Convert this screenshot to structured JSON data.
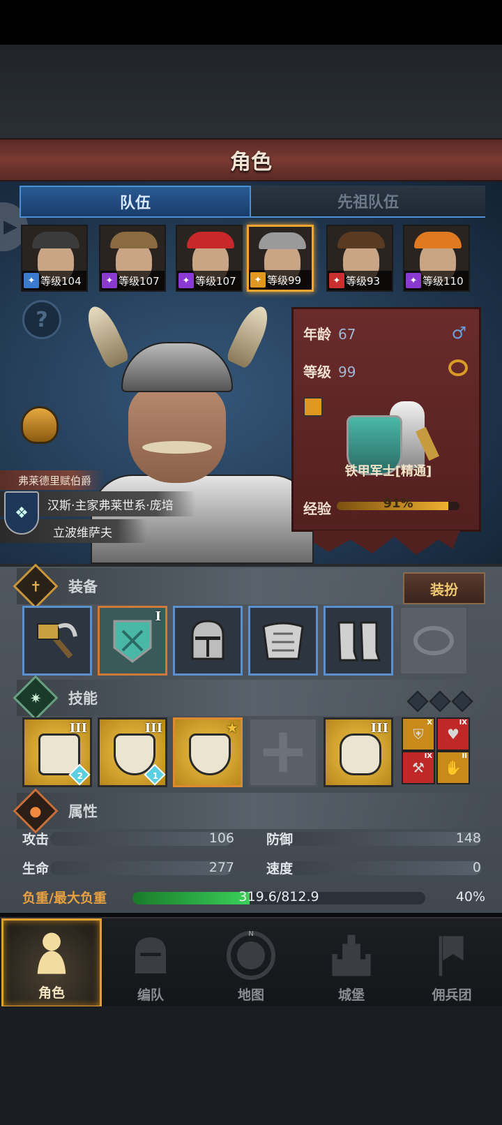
{
  "header": {
    "title": "角色"
  },
  "tabs": [
    {
      "label": "队伍",
      "active": true
    },
    {
      "label": "先祖队伍",
      "active": false
    }
  ],
  "roster": [
    {
      "level_label": "等级104",
      "class_icon": "sword-class-icon",
      "class_color": "#3a7ad0",
      "hat_color": "#3b3b3b",
      "selected": false
    },
    {
      "level_label": "等级107",
      "class_icon": "staff-class-icon",
      "class_color": "#8a3ad0",
      "hat_color": "#8a6a40",
      "selected": false
    },
    {
      "level_label": "等级107",
      "class_icon": "staff-class-icon",
      "class_color": "#8a3ad0",
      "hat_color": "#c8282a",
      "selected": false
    },
    {
      "level_label": "等级99",
      "class_icon": "shield-class-icon",
      "class_color": "#e09820",
      "hat_color": "#9a9a9a",
      "selected": true
    },
    {
      "level_label": "等级93",
      "class_icon": "fist-class-icon",
      "class_color": "#c83030",
      "hat_color": "#5a3a20",
      "selected": false
    },
    {
      "level_label": "等级110",
      "class_icon": "staff-class-icon",
      "class_color": "#8a3ad0",
      "hat_color": "#e07a20",
      "selected": false
    }
  ],
  "character": {
    "title": "弗莱德里赋伯爵",
    "name": "汉斯·主家弗莱世系·庞培",
    "origin": "立波维萨夫",
    "age_label": "年龄",
    "age": "67",
    "level_label": "等级",
    "level": "99",
    "gender_icon": "♂",
    "unit_name": "铁甲军士[精通]",
    "exp_label": "经验",
    "exp_percent": "91%",
    "exp_fraction": 0.91
  },
  "equipment": {
    "section_title": "装备",
    "dress_button": "装扮",
    "slots": [
      {
        "name": "war-hammer",
        "frame": "blue"
      },
      {
        "name": "teal-shield",
        "frame": "orange",
        "rank": "I"
      },
      {
        "name": "great-helm",
        "frame": "blue"
      },
      {
        "name": "plate-armor",
        "frame": "blue"
      },
      {
        "name": "plate-greaves",
        "frame": "blue"
      },
      {
        "name": "empty-ring-slot",
        "frame": "empty"
      }
    ]
  },
  "skills": {
    "section_title": "技能",
    "slots": [
      {
        "name": "skill-wall",
        "rank": "III",
        "rune": "2"
      },
      {
        "name": "skill-shield-bash",
        "rank": "III",
        "rune": "1"
      },
      {
        "name": "skill-dumbbell-shield",
        "rank": "★",
        "selected": true
      },
      {
        "name": "skill-empty",
        "empty": true
      },
      {
        "name": "skill-gauntlet-strength",
        "rank": "III"
      }
    ],
    "passives": [
      {
        "name": "passive-shield",
        "rank": "X",
        "color": "#c88a1a",
        "glyph": "⛨"
      },
      {
        "name": "passive-heart",
        "rank": "IX",
        "color": "#c02828",
        "glyph": "♥"
      },
      {
        "name": "passive-dumbbell",
        "rank": "IX",
        "color": "#c02828",
        "glyph": "⚒"
      },
      {
        "name": "passive-gauntlet",
        "rank": "II",
        "color": "#c88a1a",
        "glyph": "✋"
      }
    ]
  },
  "attributes": {
    "section_title": "属性",
    "attack_label": "攻击",
    "attack": "106",
    "defense_label": "防御",
    "defense": "148",
    "hp_label": "生命",
    "hp": "277",
    "speed_label": "速度",
    "speed": "0",
    "load_label": "负重/最大负重",
    "load_value": "319.6/812.9",
    "load_percent": "40%",
    "load_fraction": 0.4
  },
  "nav": [
    {
      "label": "角色",
      "active": true
    },
    {
      "label": "编队",
      "active": false
    },
    {
      "label": "地图",
      "active": false
    },
    {
      "label": "城堡",
      "active": false
    },
    {
      "label": "佣兵团",
      "active": false
    }
  ]
}
